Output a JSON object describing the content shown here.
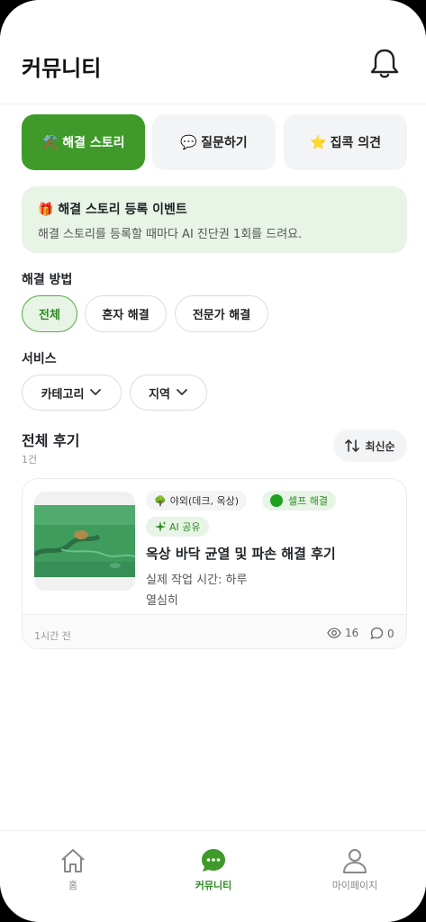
{
  "header": {
    "title": "커뮤니티",
    "bell_icon": "bell-icon"
  },
  "segments": [
    {
      "emoji": "⚒️",
      "label": "해결 스토리",
      "active": true
    },
    {
      "emoji": "💬",
      "label": "질문하기",
      "active": false
    },
    {
      "emoji": "⭐",
      "label": "집콕 의견",
      "active": false
    }
  ],
  "banner": {
    "emoji": "🎁",
    "title": "해결 스토리 등록 이벤트",
    "desc": "해결 스토리를 등록할 때마다 AI 진단권 1회를 드려요."
  },
  "method": {
    "label": "해결 방법",
    "chips": [
      "전체",
      "혼자 해결",
      "전문가 해결"
    ],
    "selected": "전체"
  },
  "service": {
    "label": "서비스",
    "dropdowns": [
      "카테고리",
      "지역"
    ]
  },
  "list": {
    "title": "전체 후기",
    "count": "1건",
    "sort_label": "최신순"
  },
  "post": {
    "location_emoji": "🌳",
    "location_tag": "야외(데크, 옥상)",
    "method_tag": "셀프 해결",
    "ai_tag": "AI 공유",
    "title": "옥상 바닥 균열 및 파손 해결 후기",
    "line1": "실제 작업 시간: 하루",
    "line2": "열심히",
    "time": "1시간 전",
    "views": "16",
    "comments": "0"
  },
  "tabbar": {
    "items": [
      {
        "label": "홈",
        "icon": "home-icon",
        "active": false
      },
      {
        "label": "커뮤니티",
        "icon": "chat-bubble-icon",
        "active": true
      },
      {
        "label": "마이페이지",
        "icon": "person-icon",
        "active": false
      }
    ]
  },
  "colors": {
    "accent": "#3f9a2a",
    "accent_light": "#e7f4e6",
    "text": "#1f2328"
  }
}
